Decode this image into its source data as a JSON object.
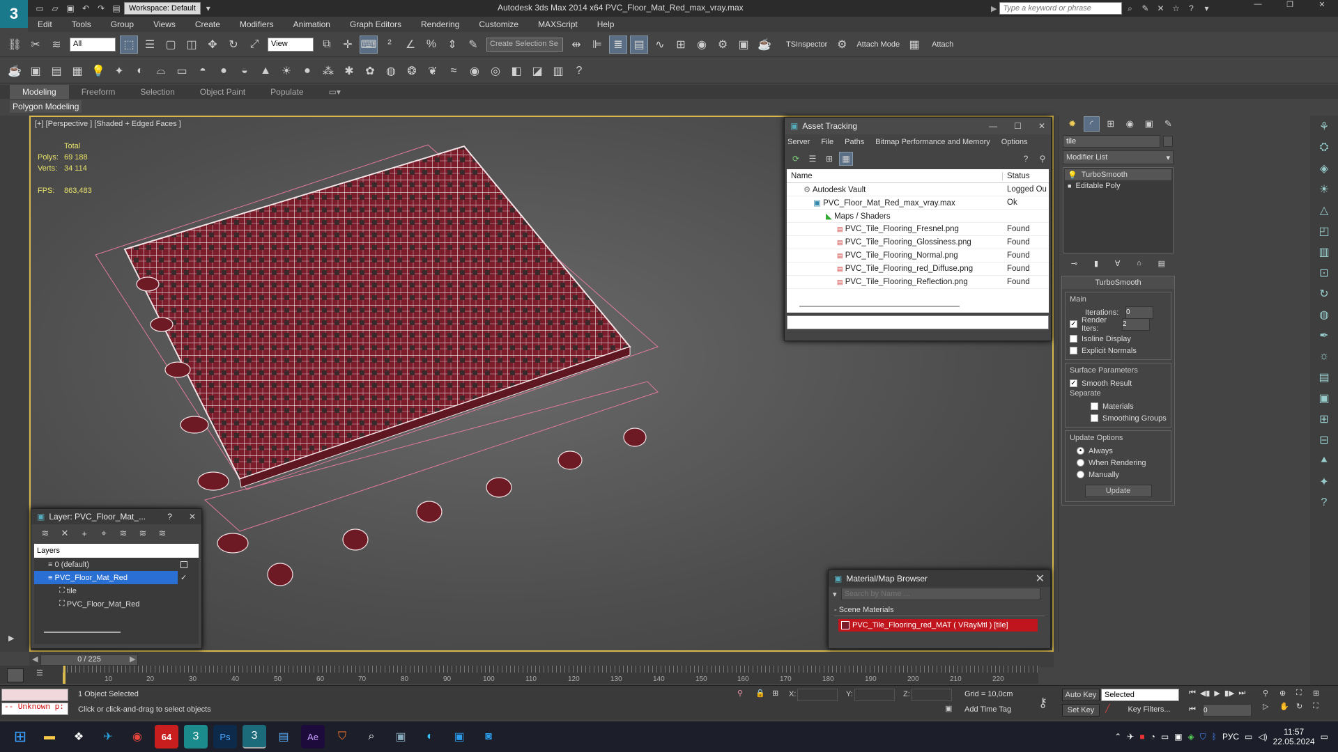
{
  "app": {
    "title": "Autodesk 3ds Max  2014 x64     PVC_Floor_Mat_Red_max_vray.max",
    "workspace": "Workspace: Default",
    "search_placeholder": "Type a keyword or phrase",
    "logo": "3"
  },
  "menu": [
    "Edit",
    "Tools",
    "Group",
    "Views",
    "Create",
    "Modifiers",
    "Animation",
    "Graph Editors",
    "Rendering",
    "Customize",
    "MAXScript",
    "Help"
  ],
  "toolbar": {
    "selection_filter": "All",
    "ref_coord": "View",
    "named_selection": "Create Selection Se",
    "tsinspector": "TSInspector",
    "attach_mode": "Attach Mode",
    "attach": "Attach"
  },
  "ribbon": {
    "tabs": [
      "Modeling",
      "Freeform",
      "Selection",
      "Object Paint",
      "Populate"
    ],
    "active_tab": "Modeling",
    "sub": "Polygon Modeling"
  },
  "viewport": {
    "label": "[+] [Perspective ] [Shaded + Edged Faces ]",
    "stats": {
      "total_label": "Total",
      "polys_label": "Polys:",
      "polys": "69 188",
      "verts_label": "Verts:",
      "verts": "34 114",
      "fps_label": "FPS:",
      "fps": "863,483"
    },
    "wire_color": "#8a1f2e"
  },
  "asset_tracking": {
    "title": "Asset Tracking",
    "menu": [
      "Server",
      "File",
      "Paths",
      "Bitmap Performance and Memory",
      "Options"
    ],
    "columns": [
      "Name",
      "Status"
    ],
    "rows": [
      {
        "name": "Autodesk Vault",
        "status": "Logged Ou"
      },
      {
        "name": "PVC_Floor_Mat_Red_max_vray.max",
        "status": "Ok"
      },
      {
        "name": "Maps / Shaders",
        "status": ""
      },
      {
        "name": "PVC_Tile_Flooring_Fresnel.png",
        "status": "Found"
      },
      {
        "name": "PVC_Tile_Flooring_Glossiness.png",
        "status": "Found"
      },
      {
        "name": "PVC_Tile_Flooring_Normal.png",
        "status": "Found"
      },
      {
        "name": "PVC_Tile_Flooring_red_Diffuse.png",
        "status": "Found"
      },
      {
        "name": "PVC_Tile_Flooring_Reflection.png",
        "status": "Found"
      }
    ]
  },
  "layer_window": {
    "title": "Layer: PVC_Floor_Mat_...",
    "help": "?",
    "header": "Layers",
    "items": [
      {
        "label": "0 (default)"
      },
      {
        "label": "PVC_Floor_Mat_Red"
      },
      {
        "label": "tile"
      },
      {
        "label": "PVC_Floor_Mat_Red"
      }
    ]
  },
  "material_browser": {
    "title": "Material/Map Browser",
    "search_placeholder": "Search by Name ...",
    "section": "- Scene Materials",
    "material": "PVC_Tile_Flooring_red_MAT  ( VRayMtl )  [tile]"
  },
  "command_panel": {
    "object_name": "tile",
    "modifier_list": "Modifier List",
    "stack": [
      "TurboSmooth",
      "Editable Poly"
    ],
    "rollout_title": "TurboSmooth",
    "main_label": "Main",
    "iterations_label": "Iterations:",
    "iterations": "0",
    "render_iters_label": "Render Iters:",
    "render_iters": "2",
    "isoline": "Isoline Display",
    "explicit_normals": "Explicit Normals",
    "surface_params": "Surface Parameters",
    "smooth_result": "Smooth Result",
    "separate": "Separate",
    "materials": "Materials",
    "smoothing_groups": "Smoothing Groups",
    "update_options": "Update Options",
    "always": "Always",
    "when_rendering": "When Rendering",
    "manually": "Manually",
    "update_button": "Update"
  },
  "timeline": {
    "frame": "0 / 225",
    "ticks": [
      "10",
      "20",
      "30",
      "40",
      "50",
      "60",
      "70",
      "80",
      "90",
      "100",
      "110",
      "120",
      "130",
      "140",
      "150",
      "160",
      "170",
      "180",
      "190",
      "200",
      "210",
      "220"
    ]
  },
  "status": {
    "selected": "1 Object Selected",
    "prompt": "Click or click-and-drag to select objects",
    "maxscript": "-- Unknown p:",
    "x_label": "X:",
    "y_label": "Y:",
    "z_label": "Z:",
    "grid": "Grid = 10,0cm",
    "add_time_tag": "Add Time Tag",
    "auto_key": "Auto Key",
    "set_key": "Set Key",
    "key_mode": "Selected",
    "key_filters": "Key Filters...",
    "frame_field": "0"
  },
  "taskbar": {
    "lang": "РУС",
    "time": "11:57",
    "date": "22.05.2024",
    "badge": "64"
  }
}
